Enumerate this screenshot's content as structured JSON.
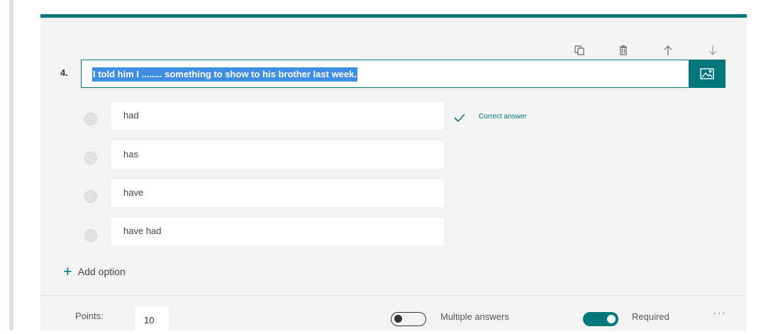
{
  "question": {
    "number": "4.",
    "text": "I told him I ........ something to show to his brother last week."
  },
  "toolbar": {
    "icons": [
      "copy-icon",
      "delete-icon",
      "move-up-icon",
      "move-down-icon"
    ]
  },
  "options": [
    {
      "label": "had",
      "correct": true
    },
    {
      "label": "has",
      "correct": false
    },
    {
      "label": "have",
      "correct": false
    },
    {
      "label": "have had",
      "correct": false
    }
  ],
  "correct_answer_label": "Correct answer",
  "add_option_label": "Add option",
  "footer": {
    "points_label": "Points:",
    "points_value": "10",
    "multiple_answers_label": "Multiple answers",
    "multiple_answers_on": false,
    "required_label": "Required",
    "required_on": true,
    "more_label": "···"
  },
  "colors": {
    "accent": "#03787c",
    "selection": "#3f8ee6",
    "card_bg": "#f3f3f3"
  }
}
